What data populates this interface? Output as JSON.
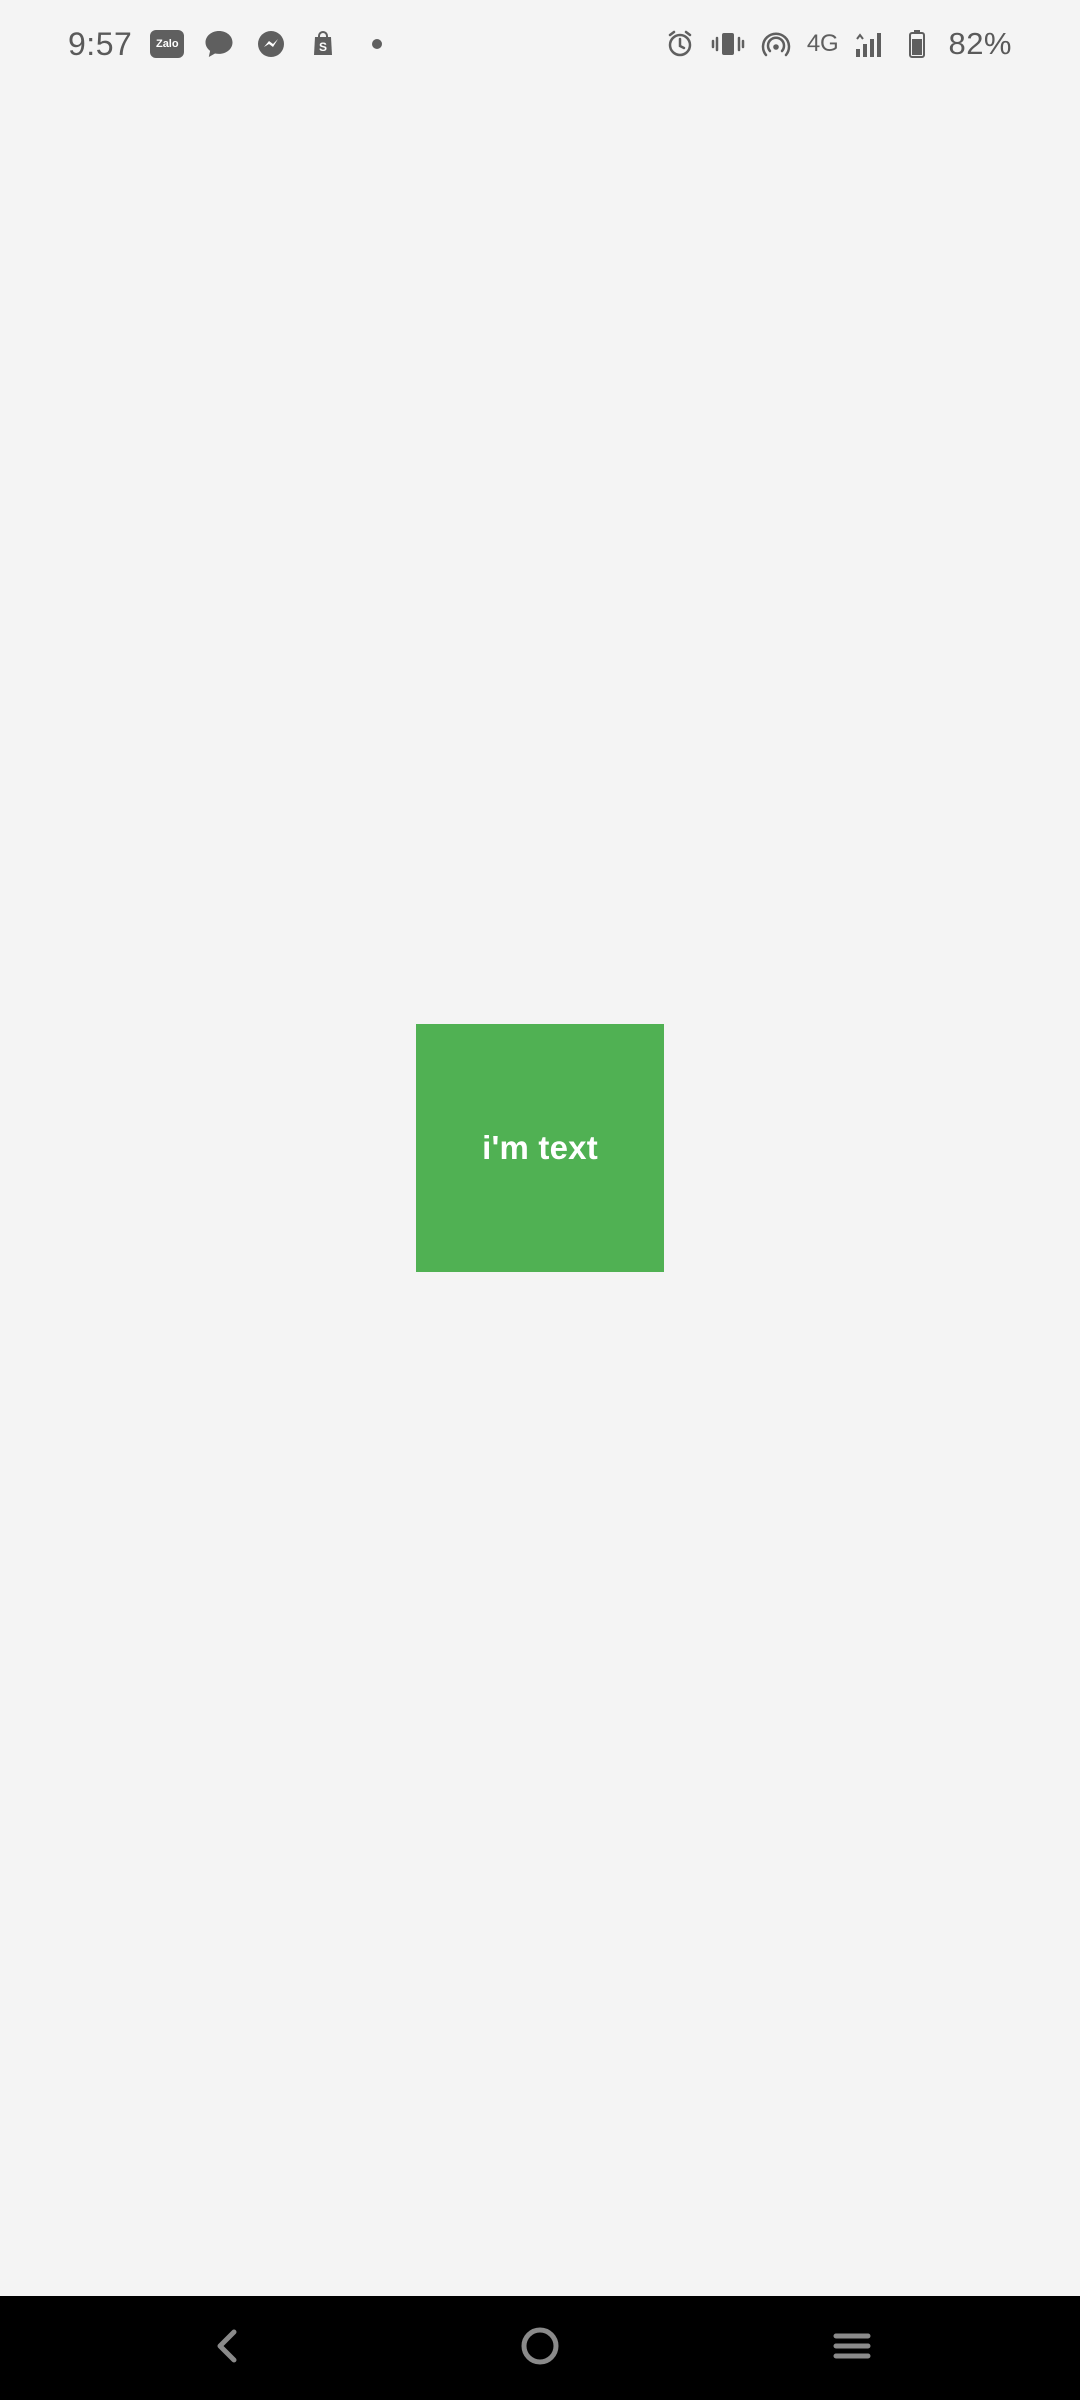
{
  "status_bar": {
    "time": "9:57",
    "battery_percent_text": "82%",
    "network_label": "4G",
    "left_icons": [
      "zalo-icon",
      "chat-bubble-icon",
      "messenger-icon",
      "shopping-bag-icon",
      "more-notifications-icon"
    ],
    "right_icons": [
      "alarm-icon",
      "vibrate-icon",
      "hotspot-icon",
      "network-4g-icon",
      "signal-icon",
      "battery-icon"
    ],
    "zalo_badge_text": "Zalo",
    "shopping_badge_text": "S",
    "battery_level": 0.82
  },
  "main": {
    "box_label": "i'm text",
    "box_color": "#50b153"
  },
  "navigation": {
    "items": [
      "back-button",
      "home-button",
      "recent-apps-button"
    ]
  },
  "colors": {
    "background": "#f4f4f4",
    "status_icon": "#5f5f5f",
    "nav_bar": "#000000",
    "nav_icon": "#8a8a8a"
  }
}
